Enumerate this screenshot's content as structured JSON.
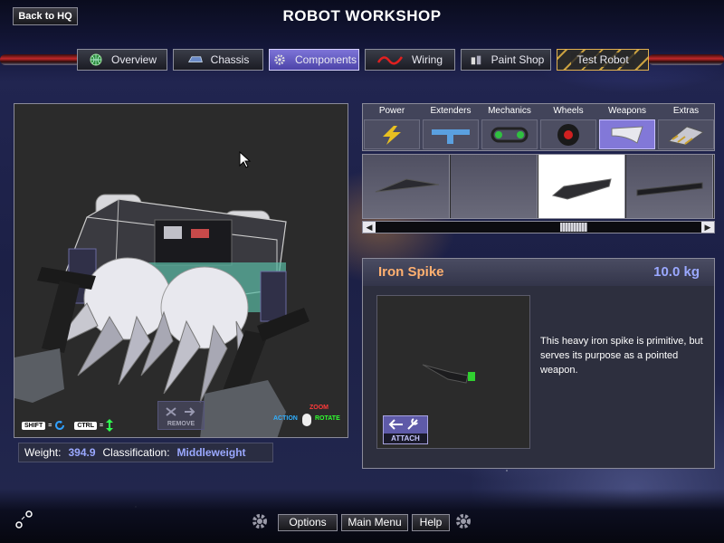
{
  "header": {
    "title": "ROBOT WORKSHOP",
    "back_label": "Back to HQ"
  },
  "tabs": [
    {
      "label": "Overview",
      "icon": "globe-icon",
      "active": false
    },
    {
      "label": "Chassis",
      "icon": "chassis-icon",
      "active": false
    },
    {
      "label": "Components",
      "icon": "gear-icon",
      "active": true
    },
    {
      "label": "Wiring",
      "icon": "wire-icon",
      "active": false
    },
    {
      "label": "Paint Shop",
      "icon": "paint-can-icon",
      "active": false
    },
    {
      "label": "Test Robot",
      "icon": "",
      "active": false
    }
  ],
  "viewport": {
    "shift_key": "SHIFT",
    "ctrl_key": "CTRL",
    "remove_label": "REMOVE",
    "zoom_label": "ZOOM",
    "action_label": "ACTION",
    "rotate_label": "ROTATE"
  },
  "stats": {
    "weight_label": "Weight:",
    "weight_value": "394.9",
    "class_label": "Classification:",
    "class_value": "Middleweight"
  },
  "categories": [
    {
      "label": "Power",
      "icon": "lightning-icon",
      "active": false
    },
    {
      "label": "Extenders",
      "icon": "extender-icon",
      "active": false
    },
    {
      "label": "Mechanics",
      "icon": "chain-drive-icon",
      "active": false
    },
    {
      "label": "Wheels",
      "icon": "wheel-icon",
      "active": false
    },
    {
      "label": "Weapons",
      "icon": "blade-icon",
      "active": true
    },
    {
      "label": "Extras",
      "icon": "wedge-icon",
      "active": false
    }
  ],
  "parts": [
    {
      "icon": "spike-part-icon",
      "selected": false
    },
    {
      "icon": "empty-part-slot",
      "selected": false
    },
    {
      "icon": "iron-spike-part-icon",
      "selected": true
    },
    {
      "icon": "blade-part-icon",
      "selected": false
    }
  ],
  "detail": {
    "name": "Iron Spike",
    "weight": "10.0 kg",
    "description": "This heavy iron spike is primitive, but serves its purpose as a pointed weapon.",
    "attach_label": "ATTACH"
  },
  "footer": {
    "options_label": "Options",
    "main_menu_label": "Main Menu",
    "help_label": "Help"
  },
  "colors": {
    "accent": "#8278d8",
    "part_name": "#ffb070",
    "value_blue": "#9aa8ff"
  }
}
